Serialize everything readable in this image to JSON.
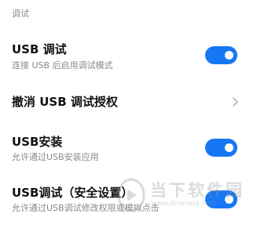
{
  "section_header": "调试",
  "items": [
    {
      "title": "USB 调试",
      "subtitle": "连接 USB 后启用调试模式",
      "control": "toggle",
      "enabled": true
    },
    {
      "title": "撤消 USB 调试授权",
      "control": "chevron"
    },
    {
      "title": "USB安装",
      "subtitle": "允许通过USB安装应用",
      "control": "toggle",
      "enabled": true
    },
    {
      "title": "USB调试（安全设置）",
      "subtitle": "允许通过USB调试修改权限或模拟点击",
      "control": "toggle",
      "enabled": true
    }
  ],
  "watermark": {
    "text": "当下软件园",
    "url": "www.downxia.com"
  },
  "colors": {
    "toggle_on": "#1677f5",
    "section_header": "#8a8a8a",
    "subtitle": "#888888"
  }
}
